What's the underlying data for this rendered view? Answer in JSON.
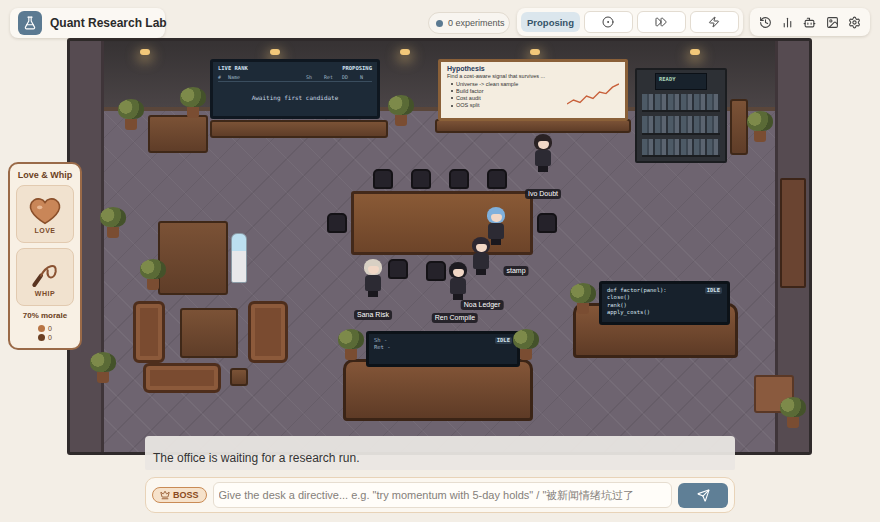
{
  "app": {
    "title": "Quant Research Lab"
  },
  "experiments": {
    "label": "0 experiments"
  },
  "phase": {
    "label": "Proposing",
    "active": true
  },
  "scene": {
    "rank_board": {
      "title": "LIVE RANK",
      "status": "PROPOSING",
      "columns": [
        "#",
        "Name",
        "Sh",
        "Ret",
        "DD",
        "N"
      ],
      "empty": "Awaiting first candidate"
    },
    "whiteboard": {
      "title": "Hypothesis",
      "goal": "Find a cost-aware signal that survives ...",
      "steps": [
        "Universe -> clean sample",
        "Build factor",
        "Cost audit",
        "OOS split"
      ],
      "sketch": [
        3,
        4,
        3.4,
        5,
        4.4,
        6,
        5.6,
        7.2,
        8
      ]
    },
    "status_monitor": {
      "label": "READY"
    },
    "desk_monitor": {
      "status": "IDLE",
      "lines": [
        "Sh -",
        "Ret -"
      ]
    },
    "code_monitor": {
      "status": "IDLE",
      "lines": [
        "def factor(panel):",
        "close()",
        "rank()",
        "apply_costs()"
      ]
    },
    "agents": [
      {
        "name": "Ivo Doubt",
        "color": "#2a2224"
      },
      {
        "name": "Sana Risk",
        "color": "#d8d0c4"
      },
      {
        "name": "Ren Compile",
        "color": "#1d1b21"
      },
      {
        "name": "Noa Ledger",
        "color": "#2d2832"
      },
      {
        "name": "stamp",
        "color": "#7fb0dc"
      }
    ]
  },
  "morale": {
    "title": "Love & Whip",
    "love": "LOVE",
    "whip": "WHIP",
    "reading": "70% morale",
    "love_count": "0",
    "whip_count": "0"
  },
  "narration": "The office is waiting for a research run.",
  "composer": {
    "role": "BOSS",
    "placeholder": "Give the desk a directive... e.g. \"try momentum with 5-day holds\" / \"被新闻情绪坑过了"
  }
}
